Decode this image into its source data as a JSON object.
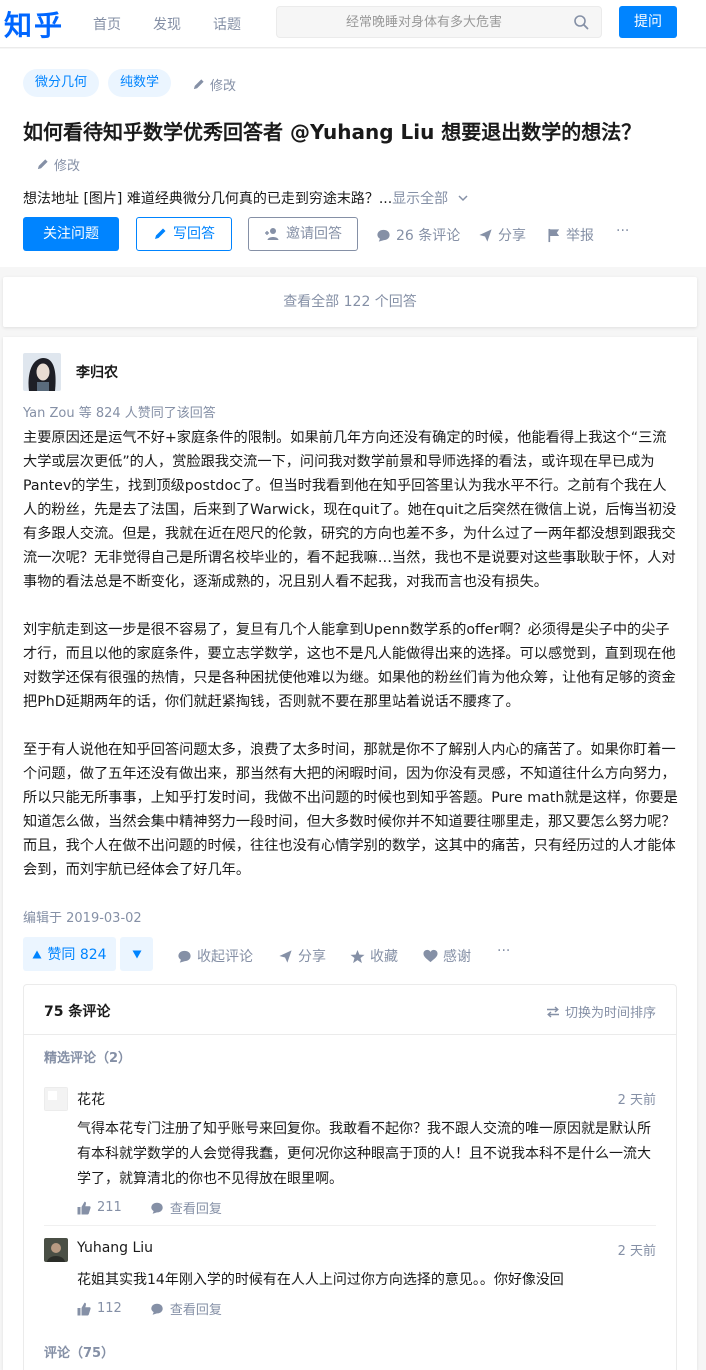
{
  "header": {
    "logo": "知乎",
    "nav": [
      "首页",
      "发现",
      "话题"
    ],
    "search_placeholder": "经常晚睡对身体有多大危害",
    "ask_label": "提问"
  },
  "question": {
    "topics": [
      "微分几何",
      "纯数学"
    ],
    "edit_label": "修改",
    "title": "如何看待知乎数学优秀回答者 @Yuhang Liu 想要退出数学的想法？",
    "title_edit_label": "修改",
    "description": "想法地址 [图片] 难道经典微分几何真的已走到穷途末路？...",
    "show_all": "显示全部",
    "follow_label": "关注问题",
    "write_label": "写回答",
    "invite_label": "邀请回答",
    "comments_label": "26 条评论",
    "share_label": "分享",
    "report_label": "举报",
    "more_label": "···"
  },
  "view_all": "查看全部 122 个回答",
  "answer": {
    "author": "李归农",
    "votes_line": "Yan Zou 等 824 人赞同了该回答",
    "paragraphs": [
      "主要原因还是运气不好+家庭条件的限制。如果前几年方向还没有确定的时候，他能看得上我这个“三流大学或层次更低”的人，赏脸跟我交流一下，问问我对数学前景和导师选择的看法，或许现在早已成为Pantev的学生，找到顶级postdoc了。但当时我看到他在知乎回答里认为我水平不行。之前有个我在人人的粉丝，先是去了法国，后来到了Warwick，现在quit了。她在quit之后突然在微信上说，后悔当初没有多跟人交流。但是，我就在近在咫尺的伦敦，研究的方向也差不多，为什么过了一两年都没想到跟我交流一次呢？无非觉得自己是所谓名校毕业的，看不起我嘛…当然，我也不是说要对这些事耿耿于怀，人对事物的看法总是不断变化，逐渐成熟的，况且别人看不起我，对我而言也没有损失。",
      "刘宇航走到这一步是很不容易了，复旦有几个人能拿到Upenn数学系的offer啊？必须得是尖子中的尖子才行，而且以他的家庭条件，要立志学数学，这也不是凡人能做得出来的选择。可以感觉到，直到现在他对数学还保有很强的热情，只是各种困扰使他难以为继。如果他的粉丝们肯为他众筹，让他有足够的资金把PhD延期两年的话，你们就赶紧掏钱，否则就不要在那里站着说话不腰疼了。",
      "至于有人说他在知乎回答问题太多，浪费了太多时间，那就是你不了解别人内心的痛苦了。如果你盯着一个问题，做了五年还没有做出来，那当然有大把的闲暇时间，因为你没有灵感，不知道往什么方向努力，所以只能无所事事，上知乎打发时间，我做不出问题的时候也到知乎答题。Pure math就是这样，你要是知道怎么做，当然会集中精神努力一段时间，但大多数时候你并不知道要往哪里走，那又要怎么努力呢？而且，我个人在做不出问题的时候，往往也没有心情学别的数学，这其中的痛苦，只有经历过的人才能体会到，而刘宇航已经体会了好几年。"
    ],
    "edited": "编辑于 2019-03-02",
    "vote_label": "赞同 824",
    "collapse_comments": "收起评论",
    "share": "分享",
    "collect": "收藏",
    "thanks": "感谢",
    "more": "···"
  },
  "comments": {
    "count_label": "75 条评论",
    "sort_label": "切换为时间排序",
    "featured_label": "精选评论（2）",
    "all_label": "评论（75）",
    "items": [
      {
        "name": "花花",
        "time": "2 天前",
        "text": "气得本花专门注册了知乎账号来回复你。我敢看不起你？我不跟人交流的唯一原因就是默认所有本科就学数学的人会觉得我蠢，更何况你这种眼高于顶的人！且不说我本科不是什么一流大学了，就算清北的你也不见得放在眼里啊。",
        "likes": "211",
        "reply": "查看回复"
      },
      {
        "name": "Yuhang Liu",
        "time": "2 天前",
        "text": "花姐其实我14年刚入学的时候有在人人上问过你方向选择的意见。。你好像没回",
        "likes": "112",
        "reply": "查看回复"
      }
    ]
  },
  "colors": {
    "brand": "#0084ff",
    "gray": "#8590a6"
  }
}
